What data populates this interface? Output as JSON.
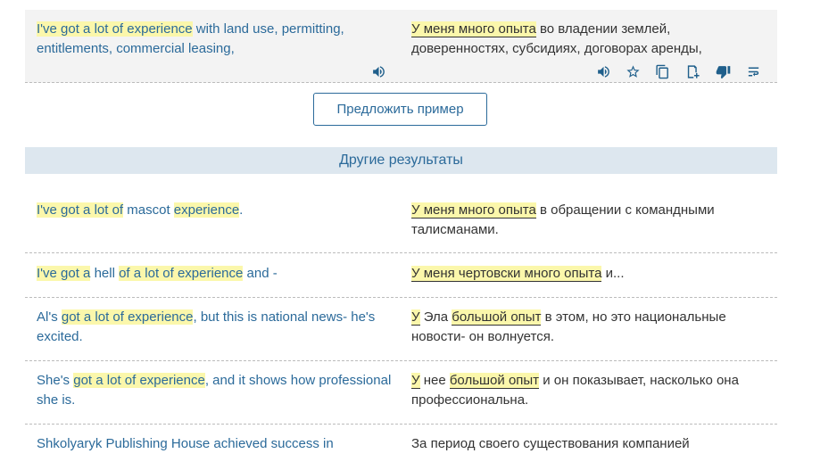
{
  "top_example": {
    "src": [
      {
        "t": "I've got a lot of experience",
        "hl": true
      },
      {
        "t": " with land use, permitting, entitlements, commercial leasing,",
        "hl": false
      }
    ],
    "trg": [
      {
        "t": "У меня много опыта",
        "hl": true
      },
      {
        "t": " во владении землей, доверенностях, субсидиях, договорах аренды,",
        "hl": false
      }
    ],
    "icons": [
      "speaker-icon",
      "speaker-icon",
      "star-icon",
      "copy-icon",
      "add-phrasebook-icon",
      "thumbs-down-icon",
      "wrap-icon"
    ]
  },
  "suggest_label": "Предложить пример",
  "other_results_label": "Другие результаты",
  "rows": [
    {
      "src": [
        {
          "t": "I've got a lot of",
          "hl": true
        },
        {
          "t": " mascot ",
          "hl": false
        },
        {
          "t": "experience",
          "hl": true
        },
        {
          "t": ".",
          "hl": false
        }
      ],
      "trg": [
        {
          "t": "У меня много опыта",
          "hl": true
        },
        {
          "t": " в обращении с командными талисманами.",
          "hl": false
        }
      ]
    },
    {
      "src": [
        {
          "t": "I've got a",
          "hl": true
        },
        {
          "t": " hell ",
          "hl": false
        },
        {
          "t": "of a lot of experience",
          "hl": true
        },
        {
          "t": " and -",
          "hl": false
        }
      ],
      "trg": [
        {
          "t": "У меня чертовски много опыта",
          "hl": true
        },
        {
          "t": " и...",
          "hl": false
        }
      ]
    },
    {
      "src": [
        {
          "t": "Al's ",
          "hl": false
        },
        {
          "t": "got a lot of experience",
          "hl": true
        },
        {
          "t": ", but this is national news- he's excited.",
          "hl": false
        }
      ],
      "trg": [
        {
          "t": "У",
          "hl": true
        },
        {
          "t": " Эла ",
          "hl": false
        },
        {
          "t": "большой опыт",
          "hl": true
        },
        {
          "t": " в этом, но это национальные новости- он волнуется.",
          "hl": false
        }
      ]
    },
    {
      "src": [
        {
          "t": "She's ",
          "hl": false
        },
        {
          "t": "got a lot of experience",
          "hl": true
        },
        {
          "t": ", and it shows how professional she is.",
          "hl": false
        }
      ],
      "trg": [
        {
          "t": "У",
          "hl": true
        },
        {
          "t": " нее ",
          "hl": false
        },
        {
          "t": "большой опыт",
          "hl": true
        },
        {
          "t": " и он показывает, насколько она профессиональна.",
          "hl": false
        }
      ]
    },
    {
      "src": [
        {
          "t": "Shkolyaryk Publishing House achieved success in",
          "hl": false
        }
      ],
      "trg": [
        {
          "t": "За период своего существования компанией",
          "hl": false
        }
      ]
    }
  ]
}
